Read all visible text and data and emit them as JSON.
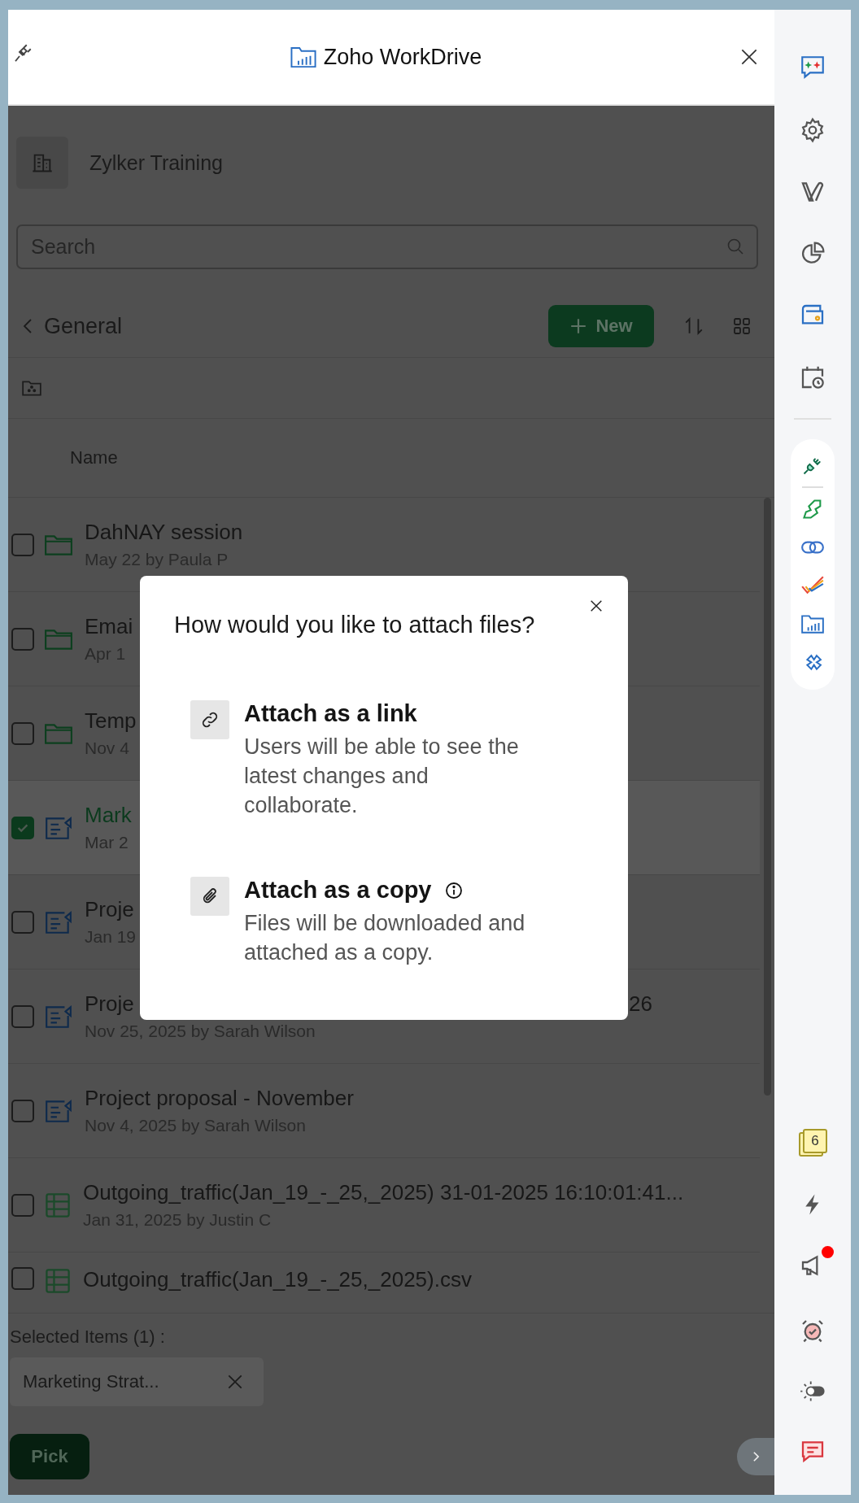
{
  "header": {
    "title": "Zoho WorkDrive"
  },
  "workspace": {
    "name": "Zylker Training"
  },
  "search": {
    "placeholder": "Search"
  },
  "folder_bar": {
    "title": "General",
    "new_button": "New"
  },
  "table": {
    "columns": [
      "Name"
    ],
    "rows": [
      {
        "kind": "folder",
        "title": "DahNAY session",
        "subtitle": "May 22 by Paula P",
        "selected": false
      },
      {
        "kind": "folder",
        "title": "Emai",
        "subtitle": "Apr 1",
        "selected": false
      },
      {
        "kind": "folder",
        "title": "Temp",
        "subtitle": "Nov 4",
        "selected": false
      },
      {
        "kind": "document",
        "title": "Mark",
        "subtitle": "Mar 2",
        "selected": true
      },
      {
        "kind": "document",
        "title": "Proje",
        "subtitle": "Jan 19",
        "selected": false
      },
      {
        "kind": "document",
        "title": "Proje",
        "title_end": "26",
        "subtitle": "Nov 25, 2025 by Sarah Wilson",
        "selected": false
      },
      {
        "kind": "document",
        "title": "Project proposal - November",
        "subtitle": "Nov 4, 2025 by Sarah Wilson",
        "selected": false
      },
      {
        "kind": "spreadsheet",
        "title": "Outgoing_traffic(Jan_19_-_25,_2025) 31-01-2025 16:10:01:41...",
        "subtitle": "Jan 31, 2025 by Justin C",
        "selected": false
      },
      {
        "kind": "spreadsheet",
        "title": "Outgoing_traffic(Jan_19_-_25,_2025).csv",
        "selected": false
      }
    ]
  },
  "selection": {
    "label": "Selected Items (1) :",
    "chips": [
      "Marketing Strat..."
    ],
    "pick_button": "Pick"
  },
  "dialog": {
    "title": "How would you like to attach files?",
    "options": [
      {
        "kind": "link",
        "title": "Attach as a link",
        "description": "Users will be able to see the latest changes and collaborate.",
        "info": false
      },
      {
        "kind": "copy",
        "title": "Attach as a copy",
        "description": "Files will be downloaded and attached as a copy.",
        "info": true
      }
    ]
  },
  "sidebar": {
    "notes_count": "6",
    "announcements_unread": true
  }
}
